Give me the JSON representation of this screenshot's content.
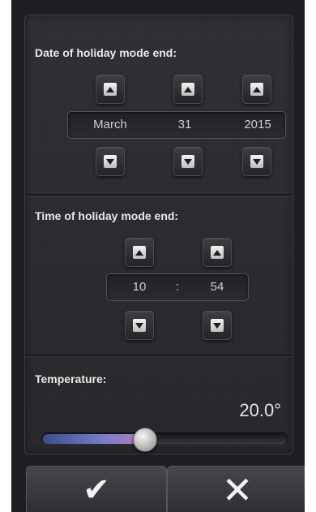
{
  "date_section": {
    "title": "Date of holiday mode end:",
    "month": "March",
    "day": "31",
    "year": "2015"
  },
  "time_section": {
    "title": "Time of holiday mode end:",
    "hour": "10",
    "separator": ":",
    "minute": "54"
  },
  "temperature_section": {
    "title": "Temperature:",
    "value": "20.0°",
    "slider_fraction": 0.42
  },
  "actions": {
    "confirm_icon": "checkmark-icon",
    "cancel_icon": "close-icon",
    "confirm_glyph": "✔",
    "cancel_glyph": "✕"
  },
  "colors": {
    "slider_fill_start": "#3a4d8f",
    "slider_fill_end": "#c07ab8"
  }
}
